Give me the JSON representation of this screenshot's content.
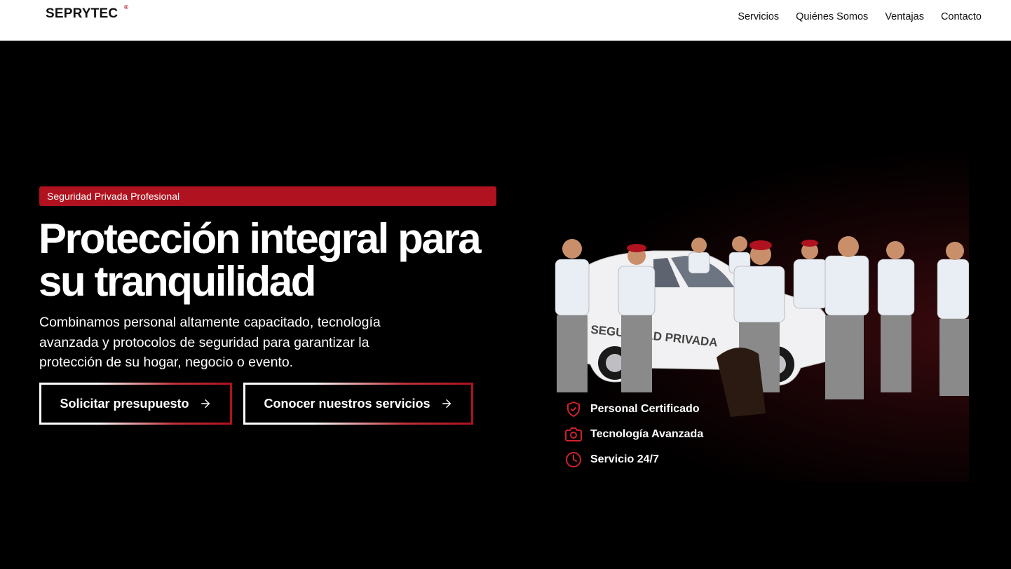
{
  "header": {
    "logo_text": "SEPRYTEC",
    "logo_mark": "®",
    "nav": [
      "Servicios",
      "Quiénes Somos",
      "Ventajas",
      "Contacto"
    ]
  },
  "hero": {
    "badge": "Seguridad Privada Profesional",
    "headline": "Protección integral para su tranquilidad",
    "subtitle": "Combinamos personal altamente capacitado, tecnología avanzada y protocolos de seguridad para garantizar la protección de su hogar, negocio o evento.",
    "buttons": {
      "primary": "Solicitar presupuesto",
      "secondary": "Conocer nuestros servicios"
    },
    "features": [
      {
        "label": "Personal Certificado",
        "icon": "shield-check-icon"
      },
      {
        "label": "Tecnología Avanzada",
        "icon": "camera-icon"
      },
      {
        "label": "Servicio 24/7",
        "icon": "clock-icon"
      }
    ],
    "photo_text": "SEGURIDAD PRIVADA"
  },
  "colors": {
    "accent": "#b0121f",
    "background": "#000000",
    "header_bg": "#ffffff"
  }
}
